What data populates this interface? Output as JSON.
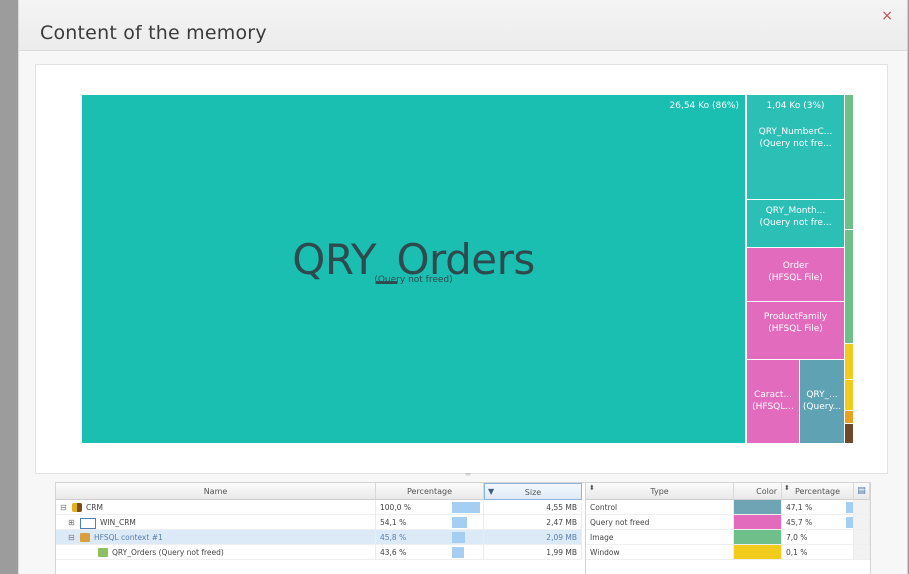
{
  "dialog": {
    "title": "Content of the memory",
    "close_glyph": "×"
  },
  "treemap": {
    "main": {
      "label": "QRY_Orders",
      "sublabel": "(Query not freed)",
      "size_label": "26,54 Ko (86%)",
      "color": "#1bbfb2"
    },
    "side_header": "1,04 Ko (3%)",
    "blocks": [
      {
        "label1": "QRY_NumberC...",
        "label2": "(Query not fre...",
        "color": "#2bbfb5"
      },
      {
        "label1": "QRY_Month...",
        "label2": "(Query not fre...",
        "color": "#2bbfb5"
      },
      {
        "label1": "Order",
        "label2": "(HFSQL File)",
        "color": "#e36bbd"
      },
      {
        "label1": "ProductFamily",
        "label2": "(HFSQL File)",
        "color": "#e36bbd"
      },
      {
        "label1": "Caract...",
        "label2": "(HFSQL...",
        "color": "#e36bbd"
      },
      {
        "label1": "QRY_...",
        "label2": "(Query...",
        "color": "#5ea2b3"
      }
    ]
  },
  "table": {
    "columns": {
      "name": "Name",
      "percentage": "Percentage",
      "size": "Size"
    },
    "rows": [
      {
        "toggle": "⊟",
        "name": "CRM",
        "percentage": "100,0 %",
        "pct_fraction": 1.0,
        "size": "4,55 MB"
      },
      {
        "toggle": "⊞",
        "name": "WIN_CRM",
        "percentage": "54,1 %",
        "pct_fraction": 0.541,
        "size": "2,47 MB"
      },
      {
        "toggle": "⊟",
        "name": "HFSQL context #1",
        "percentage": "45,8 %",
        "pct_fraction": 0.458,
        "size": "2,09 MB"
      },
      {
        "toggle": "",
        "name": "QRY_Orders (Query not freed)",
        "percentage": "43,6 %",
        "pct_fraction": 0.436,
        "size": "1,99 MB"
      }
    ]
  },
  "legend": {
    "columns": {
      "type": "Type",
      "color": "Color",
      "percentage": "Percentage"
    },
    "rows": [
      {
        "type": "Control",
        "color": "#6fa4b5",
        "percentage": "47,1 %",
        "pct_fraction": 0.471
      },
      {
        "type": "Query not freed",
        "color": "#e36bbd",
        "percentage": "45,7 %",
        "pct_fraction": 0.457
      },
      {
        "type": "Image",
        "color": "#6fbf8a",
        "percentage": "7,0 %",
        "pct_fraction": 0.07
      },
      {
        "type": "Window",
        "color": "#f2cc1c",
        "percentage": "0,1 %",
        "pct_fraction": 0.001
      }
    ]
  }
}
